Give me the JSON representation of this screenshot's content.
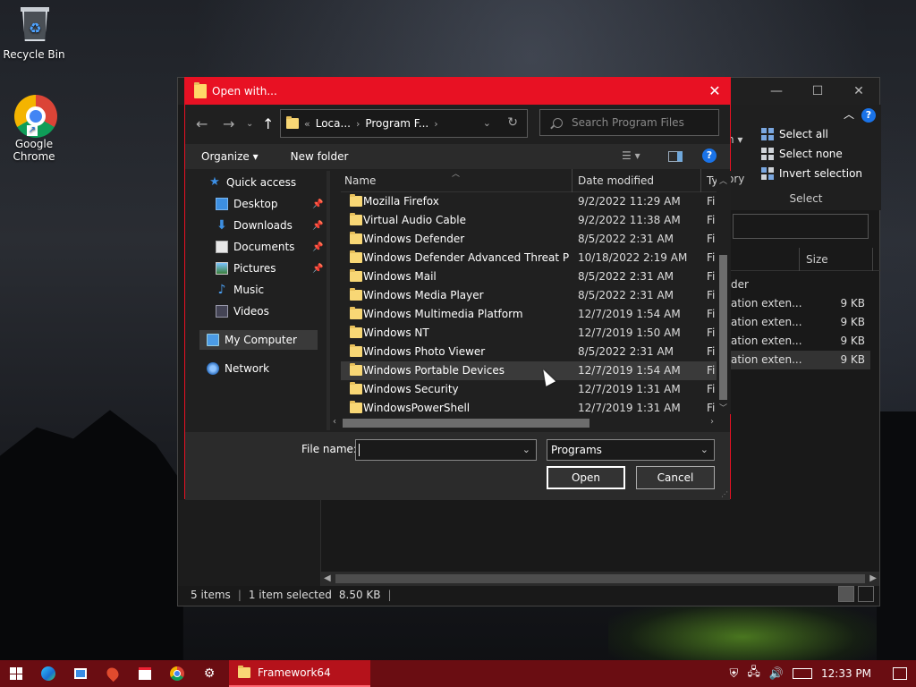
{
  "desktop": {
    "icons": [
      {
        "label": "Recycle Bin"
      },
      {
        "label": "Google Chrome"
      }
    ]
  },
  "explorer": {
    "ribbon": {
      "select_all": "Select all",
      "select_none": "Select none",
      "invert_selection": "Invert selection",
      "group_label": "Select",
      "frag_n": "n ▾",
      "frag_ory": "ory",
      "help": "?"
    },
    "list": {
      "size_header": "Size",
      "group": "der",
      "rows": [
        {
          "type": "ation exten...",
          "size": "9 KB"
        },
        {
          "type": "ation exten...",
          "size": "9 KB"
        },
        {
          "type": "ation exten...",
          "size": "9 KB"
        },
        {
          "type": "ation exten...",
          "size": "9 KB"
        }
      ]
    },
    "status": {
      "items": "5 items",
      "selected": "1 item selected",
      "size": "8.50 KB"
    }
  },
  "dialog": {
    "title": "Open with...",
    "address": {
      "prefix": "«",
      "crumb1": "Loca...",
      "crumb2": "Program F..."
    },
    "search_placeholder": "Search Program Files",
    "commands": {
      "organize": "Organize",
      "new_folder": "New folder"
    },
    "nav": {
      "quick_access": "Quick access",
      "desktop": "Desktop",
      "downloads": "Downloads",
      "documents": "Documents",
      "pictures": "Pictures",
      "music": "Music",
      "videos": "Videos",
      "my_computer": "My Computer",
      "network": "Network"
    },
    "columns": {
      "name": "Name",
      "date": "Date modified",
      "type": "Ty"
    },
    "files": [
      {
        "name": "Mozilla Firefox",
        "date": "9/2/2022 11:29 AM",
        "type": "Fi"
      },
      {
        "name": "Virtual Audio Cable",
        "date": "9/2/2022 11:38 AM",
        "type": "Fi"
      },
      {
        "name": "Windows Defender",
        "date": "8/5/2022 2:31 AM",
        "type": "Fi"
      },
      {
        "name": "Windows Defender Advanced Threat Prot...",
        "date": "10/18/2022 2:19 AM",
        "type": "Fi"
      },
      {
        "name": "Windows Mail",
        "date": "8/5/2022 2:31 AM",
        "type": "Fi"
      },
      {
        "name": "Windows Media Player",
        "date": "8/5/2022 2:31 AM",
        "type": "Fi"
      },
      {
        "name": "Windows Multimedia Platform",
        "date": "12/7/2019 1:54 AM",
        "type": "Fi"
      },
      {
        "name": "Windows NT",
        "date": "12/7/2019 1:50 AM",
        "type": "Fi"
      },
      {
        "name": "Windows Photo Viewer",
        "date": "8/5/2022 2:31 AM",
        "type": "Fi"
      },
      {
        "name": "Windows Portable Devices",
        "date": "12/7/2019 1:54 AM",
        "type": "Fi"
      },
      {
        "name": "Windows Security",
        "date": "12/7/2019 1:31 AM",
        "type": "Fi"
      },
      {
        "name": "WindowsPowerShell",
        "date": "12/7/2019 1:31 AM",
        "type": "Fi"
      }
    ],
    "filename_label": "File name:",
    "filename_value": "",
    "filetype_value": "Programs",
    "open_label": "Open",
    "cancel_label": "Cancel"
  },
  "taskbar": {
    "app_label": "Framework64",
    "clock": "12:33 PM"
  },
  "colors": {
    "accent": "#e81123",
    "taskbar": "#6a0d12",
    "taskbar_active": "#b5121b"
  }
}
